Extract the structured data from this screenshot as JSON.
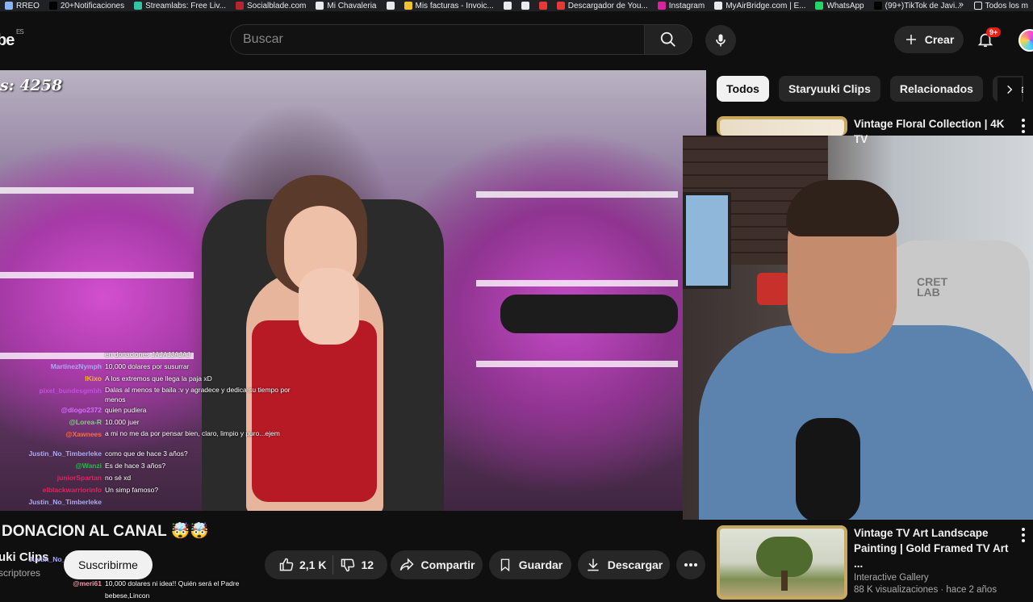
{
  "bookmarks": [
    {
      "label": "RREO",
      "icon": "folder-icon",
      "color": "#8ab4f8"
    },
    {
      "label": "20+Notificaciones",
      "icon": "x-icon",
      "color": "#000000"
    },
    {
      "label": "Streamlabs: Free Liv...",
      "icon": "streamlabs-icon",
      "color": "#31c3a2"
    },
    {
      "label": "Socialblade.com",
      "icon": "socialblade-icon",
      "color": "#b2262f"
    },
    {
      "label": "Mi Chavaleria",
      "icon": "globe-icon",
      "color": "#e8eaed"
    },
    {
      "label": "",
      "icon": "globe-icon",
      "color": "#e8eaed"
    },
    {
      "label": "Mis facturas - Invoic...",
      "icon": "invoice-icon",
      "color": "#f2c230"
    },
    {
      "label": "",
      "icon": "globe-icon",
      "color": "#e8eaed"
    },
    {
      "label": "",
      "icon": "globe-icon",
      "color": "#e8eaed"
    },
    {
      "label": "",
      "icon": "bookmark-icon",
      "color": "#e53935"
    },
    {
      "label": "Descargador de You...",
      "icon": "download-icon",
      "color": "#e53935"
    },
    {
      "label": "Instagram",
      "icon": "instagram-icon",
      "color": "#d6249f"
    },
    {
      "label": "MyAirBridge.com | E...",
      "icon": "cloud-icon",
      "color": "#e8eaed"
    },
    {
      "label": "WhatsApp",
      "icon": "whatsapp-icon",
      "color": "#25d366"
    },
    {
      "label": "(99+)TikTok de Javi...",
      "icon": "tiktok-icon",
      "color": "#000000"
    }
  ],
  "bookmarks_more": "»",
  "bookmarks_all": "Todos los m",
  "header": {
    "logo_text": "be",
    "logo_region": "ES",
    "search_placeholder": "Buscar",
    "create_label": "Crear",
    "notif_badge": "9+"
  },
  "player": {
    "viewer_text": "s: 4258"
  },
  "chat": [
    {
      "user": "",
      "user_color": "#ffffff",
      "text": "en donaciones JAJAJJAJAJ"
    },
    {
      "user": "MartinezNymph",
      "user_color": "#a9a9f5",
      "text": "10,000 dolares por susurrar"
    },
    {
      "user": "IKixo",
      "user_color": "#f7b32b",
      "text": "A los extremos que llega la paja xD"
    },
    {
      "user": "pixel_bundesgmbh",
      "user_color": "#c44ee0",
      "text": "Dalas al menos te baila :v y agradece y dedica su tiempo por menos",
      "wrap": true
    },
    {
      "user": "@diogo2372",
      "user_color": "#d66bff",
      "text": "quien pudiera"
    },
    {
      "user": "@Lorea-R",
      "user_color": "#7fcf7f",
      "text": "10.000 juer"
    },
    {
      "user": "@Xawnees",
      "user_color": "#ff6a3d",
      "text": "a mi no me da por pensar bien, claro, limpio y puro...ejem",
      "wrap": true
    },
    {
      "user": "Justin_No_Timberleke",
      "user_color": "#a9a9f5",
      "text": "como que de hace 3 años?"
    },
    {
      "user": "@Wanzi",
      "user_color": "#2db84d",
      "text": "Es de hace 3 años?"
    },
    {
      "user": "juniorSpartan",
      "user_color": "#e0245e",
      "text": "no sé xd"
    },
    {
      "user": "elblackwarriorinfo",
      "user_color": "#e0245e",
      "text": "Un simp famoso?"
    },
    {
      "user": "Justin_No_Timberleke",
      "user_color": "#a9a9f5",
      "text": ""
    },
    {
      "user": "Justin_No_Timberleke",
      "user_color": "#a9a9f5",
      "text": ""
    }
  ],
  "chat_bottom": [
    {
      "user": "Justin_No_Timberleke",
      "user_color": "#a9a9f5",
      "text": ""
    },
    {
      "user": "akodrako",
      "user_color": "#8ab4f8",
      "text": "a ya veo"
    },
    {
      "user": "@meri61",
      "user_color": "#ff8fab",
      "text": "10,000 dolares ni idea!! Quién será el Padre"
    },
    {
      "user": "",
      "user_color": "#ffffff",
      "text": "bebese,Lincon"
    }
  ],
  "video": {
    "title": "DONACION AL CANAL 🤯🤯",
    "channel": "uki Clips",
    "subscribers": "scriptores",
    "subscribe_label": "Suscribirme",
    "likes": "2,1 K",
    "dislikes": "12",
    "share_label": "Compartir",
    "save_label": "Guardar",
    "download_label": "Descargar"
  },
  "sidebar": {
    "chips": [
      "Todos",
      "Staryuuki Clips",
      "Relacionados",
      "Para ti"
    ],
    "recommendations": [
      {
        "title": "Vintage Floral Collection | 4K TV",
        "channel": "",
        "meta": ""
      },
      {
        "title": "Vintage TV Art Landscape Painting | Gold Framed TV Art ...",
        "channel": "Interactive Gallery",
        "meta": "88 K visualizaciones · hace 2 años"
      }
    ]
  },
  "colors": {
    "background": "#0f0f0f",
    "surface": "#272727",
    "accent_red": "#e62117"
  }
}
